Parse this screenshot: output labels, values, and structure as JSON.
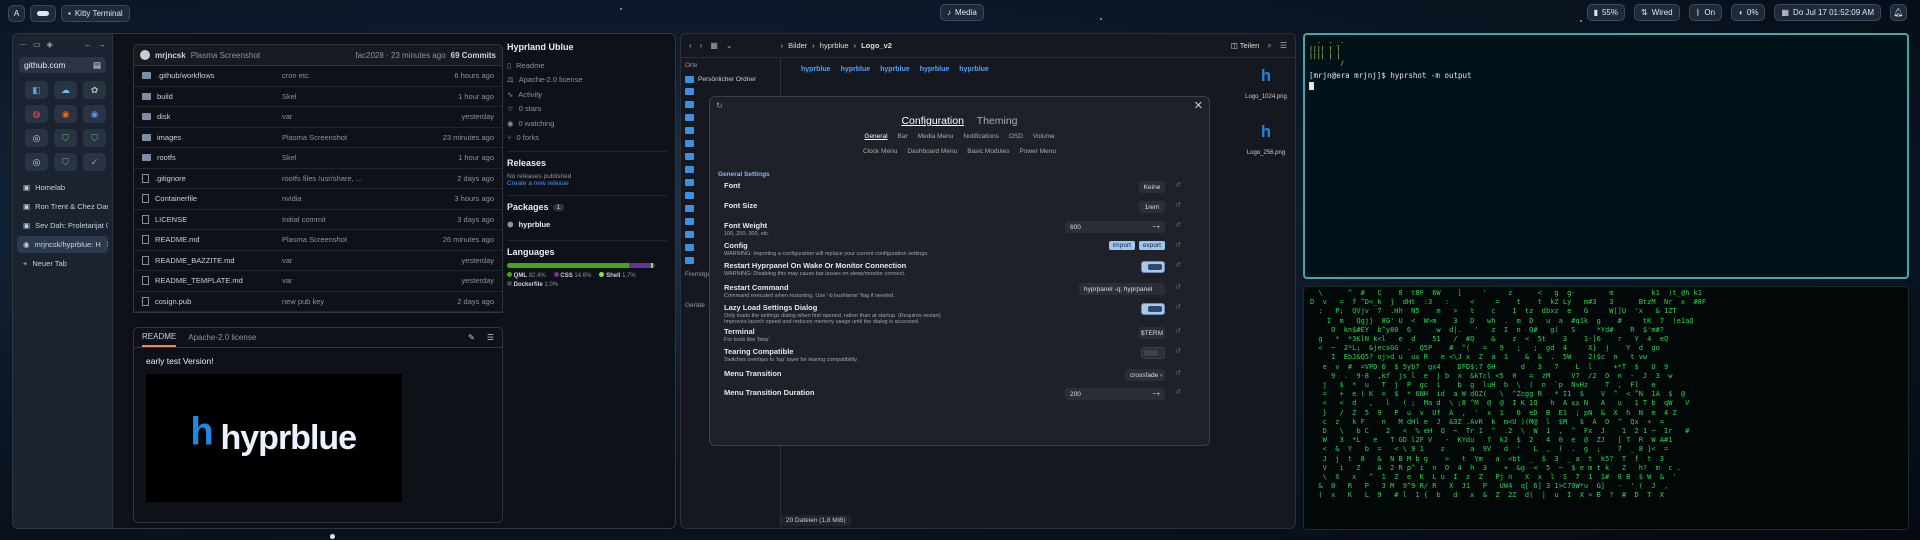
{
  "topbar": {
    "left": {
      "app_icon": "A",
      "window_title": "Kitty Terminal"
    },
    "media": "Media",
    "right": {
      "battery": "55%",
      "network": "Wired",
      "bluetooth": "On",
      "volume": "0%",
      "datetime": "Do Jul 17 01:52:09 AM"
    }
  },
  "browser": {
    "url": "github.com",
    "tabs": [
      {
        "label": "Homelab"
      },
      {
        "label": "Ron Trent & Chez Damier"
      },
      {
        "label": "Sev Dah: Proletarijat 01"
      },
      {
        "label": "mrjncsk/hyprblue: H"
      }
    ],
    "new_tab": "Neuer Tab",
    "repo": {
      "author": "mrjncsk",
      "commit_msg": "Plasma Screenshot",
      "commit_meta": "fac2028 · 23 minutes ago",
      "commits": "69 Commits",
      "files": [
        {
          "name": ".github/workflows",
          "msg": "cron etc.",
          "time": "6 hours ago",
          "type": "dir"
        },
        {
          "name": "build",
          "msg": "Skel",
          "time": "1 hour ago",
          "type": "dir"
        },
        {
          "name": "disk",
          "msg": "var",
          "time": "yesterday",
          "type": "dir"
        },
        {
          "name": "images",
          "msg": "Plasma Screenshot",
          "time": "23 minutes ago",
          "type": "dir"
        },
        {
          "name": "rootfs",
          "msg": "Skel",
          "time": "1 hour ago",
          "type": "dir"
        },
        {
          "name": ".gitignore",
          "msg": "rootfs files /usr/share, ...",
          "time": "2 days ago",
          "type": "file"
        },
        {
          "name": "Containerfile",
          "msg": "nvidia",
          "time": "3 hours ago",
          "type": "file"
        },
        {
          "name": "LICENSE",
          "msg": "Initial commit",
          "time": "3 days ago",
          "type": "file"
        },
        {
          "name": "README.md",
          "msg": "Plasma Screenshot",
          "time": "26 minutes ago",
          "type": "file"
        },
        {
          "name": "README_BAZZITE.md",
          "msg": "var",
          "time": "yesterday",
          "type": "file"
        },
        {
          "name": "README_TEMPLATE.md",
          "msg": "var",
          "time": "yesterday",
          "type": "file"
        },
        {
          "name": "cosign.pub",
          "msg": "new pub key",
          "time": "2 days ago",
          "type": "file"
        }
      ],
      "readme_tab": "README",
      "license_tab": "Apache-2.0 license",
      "readme_text": "early test Version!",
      "logo_text": "hyprblue"
    },
    "about": {
      "title": "Hyprland Ublue",
      "items": [
        "Readme",
        "Apache-2.0 license",
        "Activity",
        "0 stars",
        "0 watching",
        "0 forks"
      ],
      "releases_title": "Releases",
      "releases_none": "No releases published",
      "releases_link": "Create a new release",
      "packages_title": "Packages",
      "packages_count": "1",
      "package": "hyprblue",
      "languages_title": "Languages",
      "languages": [
        {
          "name": "QML",
          "pct": "82.4%",
          "color": "#44a51c",
          "value": 82.4
        },
        {
          "name": "CSS",
          "pct": "14.6%",
          "color": "#663399",
          "value": 14.6
        },
        {
          "name": "Shell",
          "pct": "1.7%",
          "color": "#89e051",
          "value": 1.7
        },
        {
          "name": "Dockerfile",
          "pct": "1.0%",
          "color": "#384d54",
          "value": 1.0
        }
      ]
    }
  },
  "files": {
    "breadcrumb": [
      "Bilder",
      "hyprblue",
      "Logo_v2"
    ],
    "split": "Teilen",
    "places_title": "Orte",
    "places": [
      "Persönlicher Ordner"
    ],
    "status": "20 Dateien (1,8 MiB)",
    "thumbs": [
      {
        "name": "Logo_1024.png"
      },
      {
        "name": "Logo_256.png"
      }
    ],
    "remote_title": "Fremdgeräte",
    "devices_title": "Geräte"
  },
  "settings": {
    "tabs": [
      "Configuration",
      "Theming"
    ],
    "subtabs1": [
      "General",
      "Bar",
      "Media Menu",
      "Notifications",
      "OSD",
      "Volume"
    ],
    "subtabs2": [
      "Clock Menu",
      "Dashboard Menu",
      "Basic Modules",
      "Power Menu"
    ],
    "section": "General Settings",
    "rows": [
      {
        "label": "Font",
        "desc": "",
        "value": "Keine",
        "kind": "text"
      },
      {
        "label": "Font Size",
        "desc": "",
        "value": "1rem",
        "kind": "text"
      },
      {
        "label": "Font Weight",
        "desc": "100, 200, 300, etc.",
        "value": "600",
        "kind": "num"
      },
      {
        "label": "Config",
        "desc": "WARNING: Importing a configuration will replace your current configuration settings.",
        "value": "",
        "kind": "buttons"
      },
      {
        "label": "Restart Hyprpanel On Wake Or Monitor Connection",
        "desc": "WARNING: Disabling this may cause bar issues on sleep/monitor connect.",
        "value": "",
        "kind": "toggle-on"
      },
      {
        "label": "Restart Command",
        "desc": "Command executed when restarting. Use '-b busName' flag if needed.",
        "value": "hyprpanel -q; hyprpanel",
        "kind": "text"
      },
      {
        "label": "Lazy Load Settings Dialog",
        "desc": "Only loads the settings dialog when first opened, rather than at startup. (Requires restart) Improves launch speed and reduces memory usage until the dialog is accessed.",
        "value": "",
        "kind": "toggle-on"
      },
      {
        "label": "Terminal",
        "desc": "For tools like 'btop'",
        "value": "$TERM",
        "kind": "text"
      },
      {
        "label": "Tearing Compatible",
        "desc": "Switches overlays to 'top' layer for tearing compatibility.",
        "value": "",
        "kind": "toggle-off"
      },
      {
        "label": "Menu Transition",
        "desc": "",
        "value": "crossfade",
        "kind": "select"
      },
      {
        "label": "Menu Transition Duration",
        "desc": "",
        "value": "200",
        "kind": "num"
      }
    ],
    "import": "import",
    "export": "export"
  },
  "terminal": {
    "ascii": [
      "  -  - _- ",
      "|||| | |  ",
      "|||| | |  ",
      "        /  "
    ],
    "prompt": "[mrjn@era mrjnj]$ hyprshot -m output"
  },
  "matrix_lines": [
    "  \\      ^  #   C    8  t8F  6W    ]     '     z      <   g  g-        m         k1  )t_@h k1",
    "D  v   =  f ^D<_k  j  dHt  :3   :     <     =    t    t  kZ Ly   m#3   3      BtzM  Nr  x  #8F",
    "  :   P;  QVjv  7  .Hh  N5    m   >   t    c    1  tz  dbxz  e   G     W[]U  'x   & 1ZT",
    "    I  m   Qgjj  8G' U  <  W>m    3   D   wh  .  m  D   u  a  #q1k  g    #     tK  7  )e1aQ",
    "     O  kn$#EY  b^y80  6      w  d|.   '   z  I  n  Q#   g(   S     *Yd#    R  $'m#?",
    "  g   *  *3KlN k<l   e  d    51   /  #Q    &    z  <  5t    3    1-[6    r   Y  4  eQ",
    "  <  ~  2*L;  &jecsGG  .  Q5P    #  ^(   =   9   ;   ;  gd  4     X}  j    Y  d  go",
    "     I  EbJ&Q5? oj>d u  ux R   e <\\J x  Z  a  1    &  &  .  5W    2)$c  n   t vw",
    "   e  v  #  =VPD 6  $ 5yb7  gx4    DFD$:7 6H      d   3   7    L  l     +*T  $   U  9",
    "     9  .  9-8  ,kf  js l  e  j b  x  &kTcl <5  0   =  zM     V7  /2  O  n  -  J  3  w",
    "   j   $  *  u   T  j  P  gc  i    b  g  luH  b  \\  (  n  `p  NvHz    T  ,  Fl   e",
    "   =   +  e ( K  =  $  * 6NH  id  a W dQZ(   \\  ^Zcgg R   * I1  $    V  ^  < ^N  1A  $  @",
    "   <   <  d   ,   l   ( ;  Ma d  \\ ;8 ^M  @  @  I K 1Q   h  A xx N   A   u   1 T b  qW   V",
    "   }   /  Z  5  9   P  u  v  Uf  A  ,  '  x  1   0  eD  B  E1  ; pN  &  X  h  N  m  4 Z",
    "   c  z   k F    n   M dHl e  J  &3Z .AvR  k  m<U )(M@  l  $M   $  A  O  ^  Qx  +  =",
    "   D   \\   b C    2   <  % eH  Q  ~  Tr 1  ^  .2  \\  W  1  ,  ^  Fx  J    1  2 1 ~  Ir   #",
    "   W   3  *L   e   T GD l2F V   -  KYdu   f  k2  $  2   4  0  e  @  ZJ   [ T  R  W A#1",
    "   <  &  Y   b  =   < \\ 9 1    z      a  9V   d  '   L  ,  (  .  g  ;    7  _ 8 ]<  =",
    "   J  j  t  8   &  N B M b g    >   t  Ym   a  <bt  _  $  3  _ a  t  k5?  T  f  t  3",
    "   V   i   Z    A  2 R p^ i  n  O  4  h  3    +  &g  <  5  ~  $ e m t k   Z   h?  m  c .",
    "   \\  X   x   ^  1  Z  e  K  L u  I  z  Z   Pj n   X  x  l  S  7  1  1#  8 B  $ W  &  '",
    "  &  0   R   P   3 M  9^9 R/ R   X  J1   P   UW4  q[ 6] 3 1>C79W*u  G]   -  ' (  J  ,",
    "  (  x   K   L  9   # l  1 {  b   d   x  &  Z  2Z  d(  |  u  I  X > B  ?  #  D  T  X"
  ]
}
